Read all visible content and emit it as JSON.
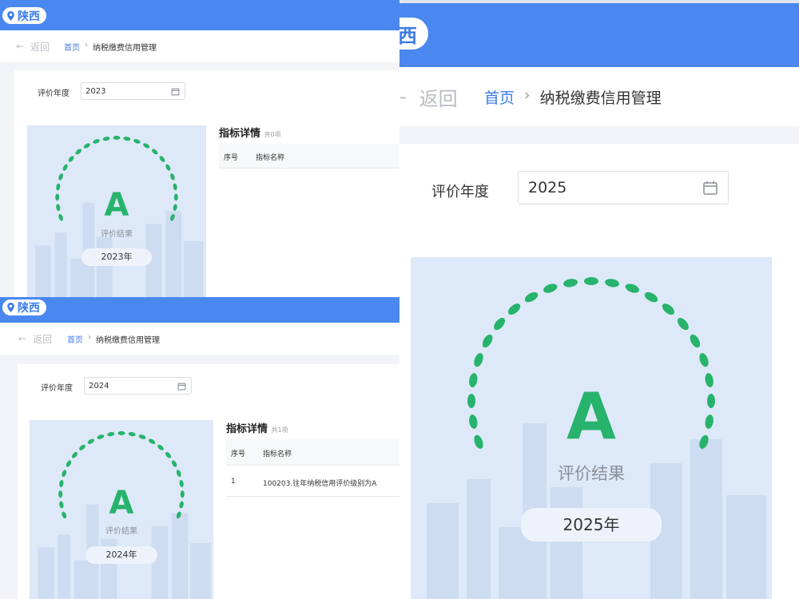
{
  "location": "陕西",
  "nav": {
    "back_label": "返回",
    "home": "首页",
    "separator": "›",
    "current": "纳税缴费信用管理"
  },
  "form": {
    "year_label": "评价年度"
  },
  "hero": {
    "result_label": "评价结果"
  },
  "details": {
    "title": "指标详情",
    "col_no": "序号",
    "col_name": "指标名称"
  },
  "panels": [
    {
      "year": "2023",
      "grade": "A",
      "year_badge": "2023年",
      "count_text": "共0项",
      "rows": []
    },
    {
      "year": "2024",
      "grade": "A",
      "year_badge": "2024年",
      "count_text": "共1项",
      "rows": [
        {
          "no": "1",
          "name": "100203.往年纳税信用评价级别为A"
        }
      ]
    },
    {
      "year": "2025",
      "grade": "A",
      "year_badge": "2025年"
    }
  ],
  "colors": {
    "brand": "#4a88ef",
    "grade": "#27b36b",
    "link": "#3d7ce8"
  }
}
